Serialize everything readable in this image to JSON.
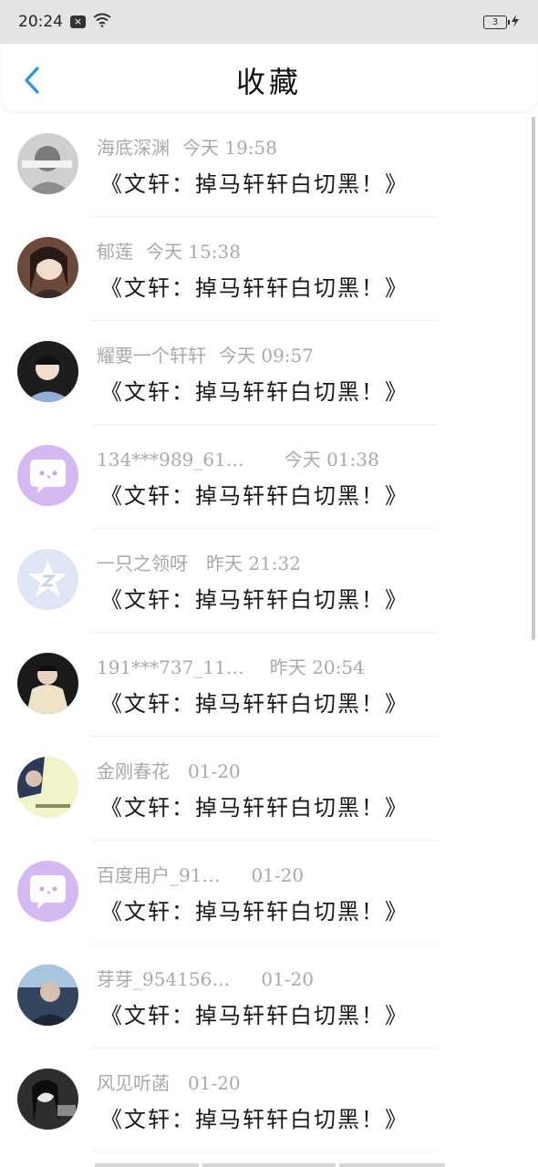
{
  "status_bar": {
    "time": "20:24",
    "battery": "3"
  },
  "header": {
    "title": "收藏"
  },
  "items": [
    {
      "name": "海底深渊",
      "time": "今天 19:58",
      "message": "《文轩：掉马轩轩白切黑！》",
      "avatar": "photo"
    },
    {
      "name": "郁莲",
      "time": "今天 15:38",
      "message": "《文轩：掉马轩轩白切黑！》",
      "avatar": "photo"
    },
    {
      "name": "耀要一个轩轩",
      "time": "今天 09:57",
      "message": "《文轩：掉马轩轩白切黑！》",
      "avatar": "photo"
    },
    {
      "name": "134***989_61…",
      "time": "今天 01:38",
      "message": "《文轩：掉马轩轩白切黑！》",
      "avatar": "chat-bubble"
    },
    {
      "name": "一只之领呀",
      "time": "昨天 21:32",
      "message": "《文轩：掉马轩轩白切黑！》",
      "avatar": "zhidao-logo"
    },
    {
      "name": "191***737_11…",
      "time": "昨天 20:54",
      "message": "《文轩：掉马轩轩白切黑！》",
      "avatar": "photo"
    },
    {
      "name": "金刚春花",
      "time": "01-20",
      "message": "《文轩：掉马轩轩白切黑！》",
      "avatar": "photo"
    },
    {
      "name": "百度用户_91…",
      "time": "01-20",
      "message": "《文轩：掉马轩轩白切黑！》",
      "avatar": "chat-bubble"
    },
    {
      "name": "芽芽_954156…",
      "time": "01-20",
      "message": "《文轩：掉马轩轩白切黑！》",
      "avatar": "photo"
    },
    {
      "name": "风见听菡",
      "time": "01-20",
      "message": "《文轩：掉马轩轩白切黑！》",
      "avatar": "photo"
    }
  ],
  "colors": {
    "accent": "#2196f3",
    "meta": "#a9a9a9",
    "bubble": "#d4b8f2"
  }
}
